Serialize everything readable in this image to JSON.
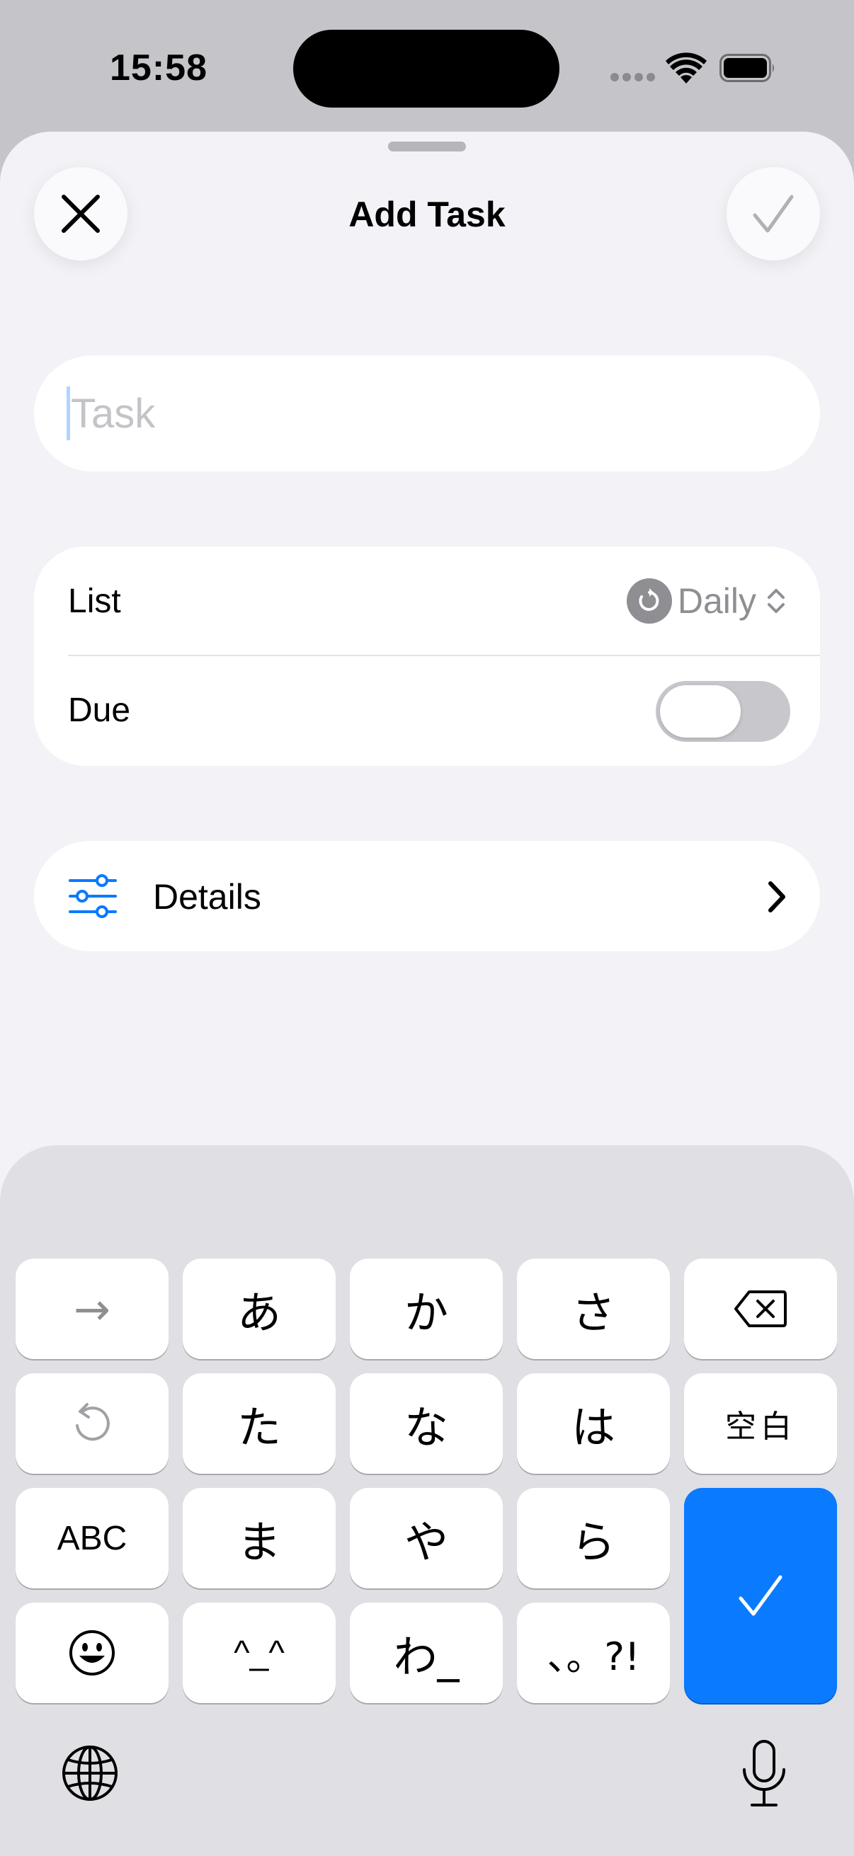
{
  "status_bar": {
    "time": "15:58"
  },
  "sheet": {
    "title": "Add Task",
    "close_icon": "xmark-icon",
    "confirm_icon": "checkmark-icon"
  },
  "task_field": {
    "placeholder": "Task",
    "value": ""
  },
  "list_row": {
    "label": "List",
    "value": "Daily",
    "icon": "repeat-icon"
  },
  "due_row": {
    "label": "Due",
    "toggle_on": false
  },
  "details_row": {
    "label": "Details",
    "icon": "sliders-icon"
  },
  "keyboard": {
    "row1": [
      "→",
      "あ",
      "か",
      "さ"
    ],
    "row2": [
      "た",
      "な",
      "は"
    ],
    "space_label": "空白",
    "row3": [
      "ABC",
      "ま",
      "や",
      "ら"
    ],
    "row4": [
      "^_^",
      "わ_",
      "、。?!"
    ],
    "colors": {
      "enter": "#0a7aff"
    }
  }
}
